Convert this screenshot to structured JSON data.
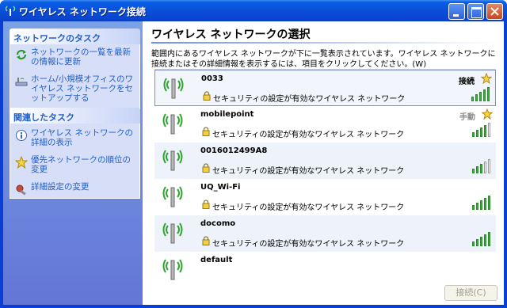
{
  "window": {
    "title": "ワイヤレス ネットワーク接続"
  },
  "taskpane": {
    "network_tasks": {
      "header": "ネットワークのタスク",
      "items": [
        {
          "label": "ネットワークの一覧を最新の情報に更新",
          "icon": "refresh-icon"
        },
        {
          "label": "ホーム/小規模オフィスのワイヤレス ネットワークをセットアップする",
          "icon": "wireless-setup-icon"
        }
      ]
    },
    "related_tasks": {
      "header": "関連したタスク",
      "items": [
        {
          "label": "ワイヤレス ネットワークの詳細の表示",
          "icon": "info-icon"
        },
        {
          "label": "優先ネットワークの順位の変更",
          "icon": "star-icon"
        },
        {
          "label": "詳細設定の変更",
          "icon": "settings-icon"
        }
      ]
    }
  },
  "main": {
    "title": "ワイヤレス ネットワークの選択",
    "description": "範囲内にあるワイヤレス ネットワークが下に一覧表示されています。ワイヤレス ネットワークに接続またはその詳細情報を表示するには、項目をクリックしてください。(W)",
    "connect_button": "接続(C)"
  },
  "networks": [
    {
      "ssid": "0033",
      "security": "セキュリティの設定が有効なワイヤレス ネットワーク",
      "status": "接続",
      "starred": true,
      "signal": 5
    },
    {
      "ssid": "mobilepoint",
      "security": "セキュリティの設定が有効なワイヤレス ネットワーク",
      "status": "手動",
      "starred": true,
      "signal": 4
    },
    {
      "ssid": "0016012499A8",
      "security": "セキュリティの設定が有効なワイヤレス ネットワーク",
      "status": "",
      "starred": false,
      "signal": 3
    },
    {
      "ssid": "UQ_Wi-Fi",
      "security": "セキュリティの設定が有効なワイヤレス ネットワーク",
      "status": "",
      "starred": false,
      "signal": 5
    },
    {
      "ssid": "docomo",
      "security": "セキュリティの設定が有効なワイヤレス ネットワーク",
      "status": "",
      "starred": false,
      "signal": 5
    },
    {
      "ssid": "default",
      "security": "",
      "status": "",
      "starred": false,
      "signal": 0
    }
  ],
  "colors": {
    "titlebar": "#0a4fd8",
    "taskpane": "#6f8fe0",
    "link": "#215dc6",
    "signal_on": "#37b237"
  }
}
